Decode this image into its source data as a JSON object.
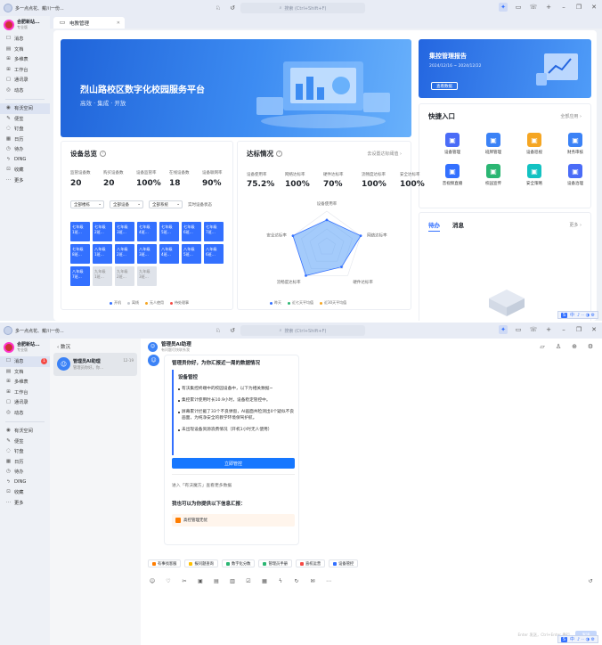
{
  "titlebar": {
    "user_text": "多一点点花、戴川一份...",
    "search_placeholder": "搜索 (Ctrl+Shift+F)"
  },
  "org": {
    "name": "合肥新站...",
    "sub": "专业版"
  },
  "nav_top": [
    "消息",
    "文档",
    "多维表",
    "工作台",
    "通讯录",
    "动态"
  ],
  "nav_bottom": [
    "有沃空间",
    "便签",
    "钉盘",
    "日历",
    "待办",
    "DING",
    "收藏",
    "更多"
  ],
  "window1": {
    "tab_label": "电教管理",
    "banner": {
      "title": "烈山路校区数字化校园服务平台",
      "subtitle": "高效 · 集成 · 开放"
    },
    "report": {
      "title": "集控管理报告",
      "date": "2024/12/16 ~ 2024/12/22",
      "button": "查看数据"
    },
    "overview": {
      "title": "设备总览",
      "stats": [
        {
          "label": "监管设备数",
          "value": "20"
        },
        {
          "label": "购买设备数",
          "value": "20"
        },
        {
          "label": "设备监管率",
          "value": "100%"
        },
        {
          "label": "在线设备数",
          "value": "18"
        },
        {
          "label": "设备联网率",
          "value": "90%"
        }
      ],
      "filters": [
        "全部楼栋",
        "全部设备",
        "全部系统"
      ],
      "filter_link": "实时设备状态",
      "grid": [
        [
          "七年级",
          "1班..."
        ],
        [
          "七年级",
          "2班..."
        ],
        [
          "七年级",
          "3班..."
        ],
        [
          "七年级",
          "4班..."
        ],
        [
          "七年级",
          "5班..."
        ],
        [
          "七年级",
          "6班..."
        ],
        [
          "七年级",
          "7班..."
        ],
        [
          "七年级",
          "8班..."
        ],
        [
          "八年级",
          "1班..."
        ],
        [
          "八年级",
          "2班..."
        ],
        [
          "八年级",
          "3班..."
        ],
        [
          "八年级",
          "4班..."
        ],
        [
          "八年级",
          "5班..."
        ],
        [
          "八年级",
          "6班..."
        ],
        [
          "八年级",
          "7班..."
        ],
        [
          "九年级",
          "1班..."
        ],
        [
          "九年级",
          "2班..."
        ],
        [
          "九年级",
          "3班..."
        ]
      ],
      "legend": [
        "开机",
        "离线",
        "无人使用",
        "待处理事"
      ]
    },
    "rates": {
      "title": "达标情况",
      "link": "去设置达标阈值",
      "items": [
        {
          "label": "设备使用率",
          "value": "75.2%"
        },
        {
          "label": "网络达标率",
          "value": "100%"
        },
        {
          "label": "硬件达标率",
          "value": "70%"
        },
        {
          "label": "流畅度达标率",
          "value": "100%"
        },
        {
          "label": "安全达标率",
          "value": "100%"
        }
      ],
      "radar_labels": [
        "设备使用率",
        "网络达标率",
        "硬件达标率",
        "流畅度达标率",
        "安全达标率"
      ],
      "radar_values": [
        0.752,
        1.0,
        0.7,
        1.0,
        1.0
      ],
      "legend": [
        "昨天",
        "近七天平均值",
        "近30天平均值"
      ]
    },
    "quick": {
      "title": "快捷入口",
      "link": "全部应用",
      "items": [
        {
          "label": "设备管理",
          "color": "#4a6cf7"
        },
        {
          "label": "班牌管理",
          "color": "#3b82f6"
        },
        {
          "label": "设备巡视",
          "color": "#f5a623"
        },
        {
          "label": "财务审核",
          "color": "#3b82f6"
        },
        {
          "label": "音视频直播",
          "color": "#3370ff"
        },
        {
          "label": "校园宣传",
          "color": "#2bb673"
        },
        {
          "label": "安全策略",
          "color": "#13c2c2"
        },
        {
          "label": "设备治理",
          "color": "#4a6cf7"
        }
      ]
    },
    "todo": {
      "tab1": "待办",
      "tab2": "消息",
      "more": "更多"
    }
  },
  "window2": {
    "back": "数沉",
    "chat": {
      "name": "管理员AI助理",
      "time": "12-19",
      "preview": "管理员你好，你..."
    },
    "header": {
      "name": "管理员AI助理",
      "sub": "有问题尽快联系我"
    },
    "bubble": {
      "title": "管理员你好，为你汇报近一周的数据情况",
      "section": "设备管控",
      "lines": [
        "有沃集控终端中的校园设备中，以下为相关数据~",
        "集控累计使用时长10.9小时，设备稳定管控中。",
        "屏幕累计拦截了33个不良弹窗，AI画面共检测出0个疑似不良画面，为纯净安全的教学环境保驾护航。",
        "未出现设备资源浪费情况（开机1小时无人使用）"
      ],
      "button": "立即管控",
      "more": "进入「有沃魔方」查看更多数据",
      "question": "我也可以为你提供以下信息汇报：",
      "option": "高控管理无忧"
    },
    "chips": [
      "有事找客服",
      "报问题查询",
      "数字化分数",
      "管理员手册",
      "直校运营",
      "设备管控"
    ],
    "chip_colors": [
      "#ff7d00",
      "#ffbf00",
      "#2bb673",
      "#2bb673",
      "#f54a45",
      "#3370ff"
    ],
    "send_hint": "Enter 发送，Ctrl+Enter 换行",
    "send_btn": "发送"
  },
  "colors": {
    "accent": "#3370ff",
    "badge": "#f54a45"
  },
  "badge_count": "1",
  "ime": {
    "label": "中"
  }
}
